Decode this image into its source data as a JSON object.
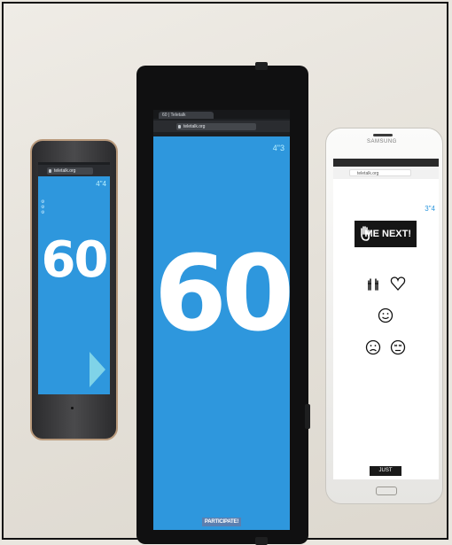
{
  "photo": {
    "background_color": "#e7e4dd"
  },
  "left_phone": {
    "url": "teletalk.org",
    "timer": "4\"4",
    "count": "60",
    "screen_color": "#2e97dd",
    "play_icon": "play-triangle-icon"
  },
  "center_tablet": {
    "tab_title": "60 | Teletalk",
    "url": "teletalk.org",
    "timer": "4\"3",
    "count": "60",
    "participate_label": "PARTICIPATE!",
    "screen_color": "#2e97dd"
  },
  "right_tablet": {
    "brand": "SAMSUNG",
    "url": "teletalk.org",
    "timer": "3\"4",
    "me_next_label": "ME NEXT!",
    "emojis": [
      "clap-icon",
      "heart-icon",
      "smile-icon",
      "sad-icon",
      "dizzy-icon"
    ],
    "just_watch_label": "JUST WATCH"
  }
}
